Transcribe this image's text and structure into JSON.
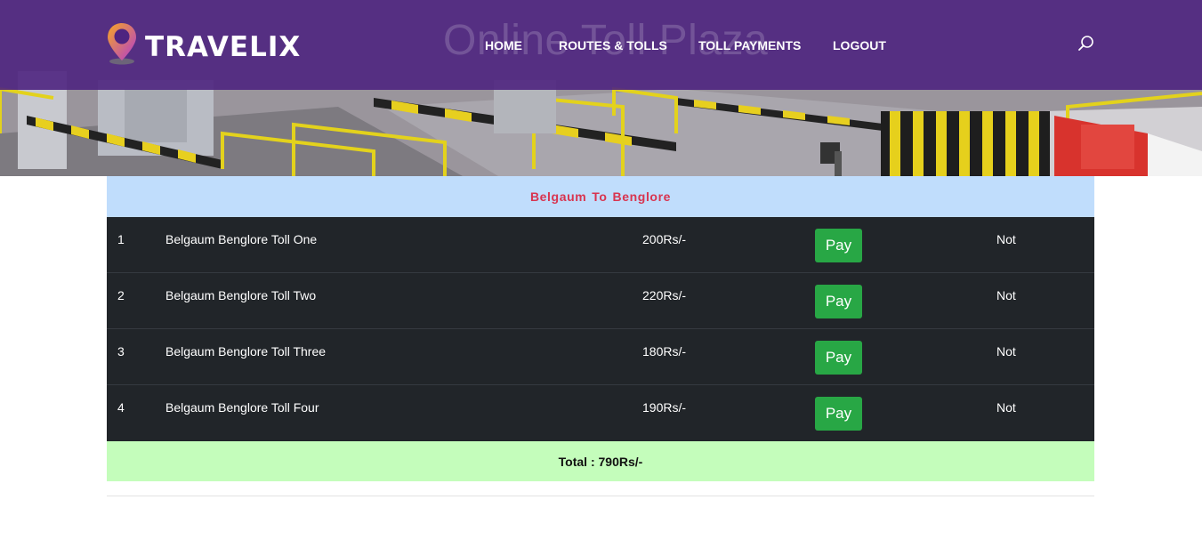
{
  "brand": {
    "name": "TRAVELIX"
  },
  "hero": {
    "title": "Online Toll Plaza"
  },
  "nav": {
    "items": [
      {
        "label": "HOME"
      },
      {
        "label": "ROUTES & TOLLS"
      },
      {
        "label": "TOLL PAYMENTS"
      },
      {
        "label": "LOGOUT"
      }
    ],
    "search_icon": "search-icon"
  },
  "route": {
    "from": "Belgaum",
    "joiner": "To",
    "to": "Benglore"
  },
  "tolls": [
    {
      "no": "1",
      "name": "Belgaum Benglore Toll One",
      "price": "200Rs/-",
      "action": "Pay",
      "status": "Not"
    },
    {
      "no": "2",
      "name": "Belgaum Benglore Toll Two",
      "price": "220Rs/-",
      "action": "Pay",
      "status": "Not"
    },
    {
      "no": "3",
      "name": "Belgaum Benglore Toll Three",
      "price": "180Rs/-",
      "action": "Pay",
      "status": "Not"
    },
    {
      "no": "4",
      "name": "Belgaum Benglore Toll Four",
      "price": "190Rs/-",
      "action": "Pay",
      "status": "Not"
    }
  ],
  "total": {
    "label": "Total : 790Rs/-"
  },
  "colors": {
    "navbar": "#4e2480",
    "route_header_bg": "#c0ddfc",
    "route_header_text": "#d8344f",
    "table_bg": "#212529",
    "pay_button": "#28a745",
    "total_bg": "#c4fdbb"
  }
}
